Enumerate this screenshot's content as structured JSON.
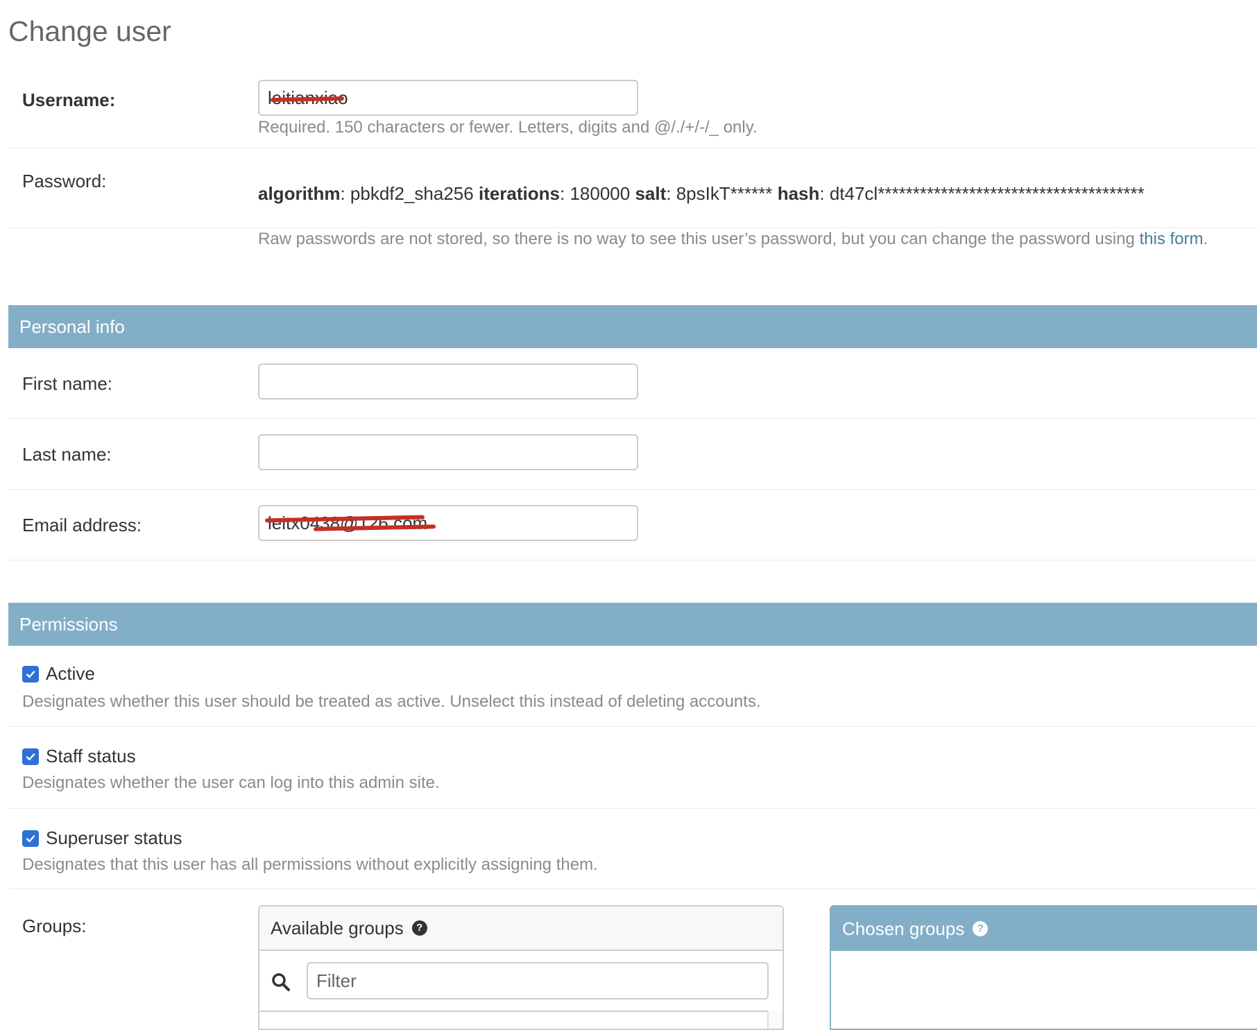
{
  "page": {
    "title": "Change user"
  },
  "username": {
    "label": "Username:",
    "value": "leitianxiao",
    "help": "Required. 150 characters or fewer. Letters, digits and @/./+/-/_ only."
  },
  "password": {
    "label": "Password:",
    "algorithm_key": "algorithm",
    "algorithm_value": "pbkdf2_sha256",
    "iterations_key": "iterations",
    "iterations_value": "180000",
    "salt_key": "salt",
    "salt_value": "8psIkT******",
    "hash_key": "hash",
    "hash_value": "dt47cl**************************************",
    "help_prefix": "Raw passwords are not stored, so there is no way to see this user’s password, but you can change the password using ",
    "help_link": "this form",
    "help_suffix": "."
  },
  "personal_info": {
    "header": "Personal info",
    "first_name": {
      "label": "First name:",
      "value": ""
    },
    "last_name": {
      "label": "Last name:",
      "value": ""
    },
    "email": {
      "label": "Email address:",
      "value": "leitx0438@126.com"
    }
  },
  "permissions": {
    "header": "Permissions",
    "active": {
      "label": "Active",
      "checked": true,
      "help": "Designates whether this user should be treated as active. Unselect this instead of deleting accounts."
    },
    "staff": {
      "label": "Staff status",
      "checked": true,
      "help": "Designates whether the user can log into this admin site."
    },
    "superuser": {
      "label": "Superuser status",
      "checked": true,
      "help": "Designates that this user has all permissions without explicitly assigning them."
    }
  },
  "groups": {
    "label": "Groups:",
    "available_title": "Available groups",
    "chosen_title": "Chosen groups",
    "filter_placeholder": "Filter"
  },
  "colors": {
    "section_header": "#83aec8",
    "link": "#447e9b",
    "checkbox": "#2f6fd6",
    "redaction": "#c62f26"
  },
  "icons": {
    "checkbox": "check-icon",
    "help": "question-circle-icon",
    "search": "search-icon"
  }
}
